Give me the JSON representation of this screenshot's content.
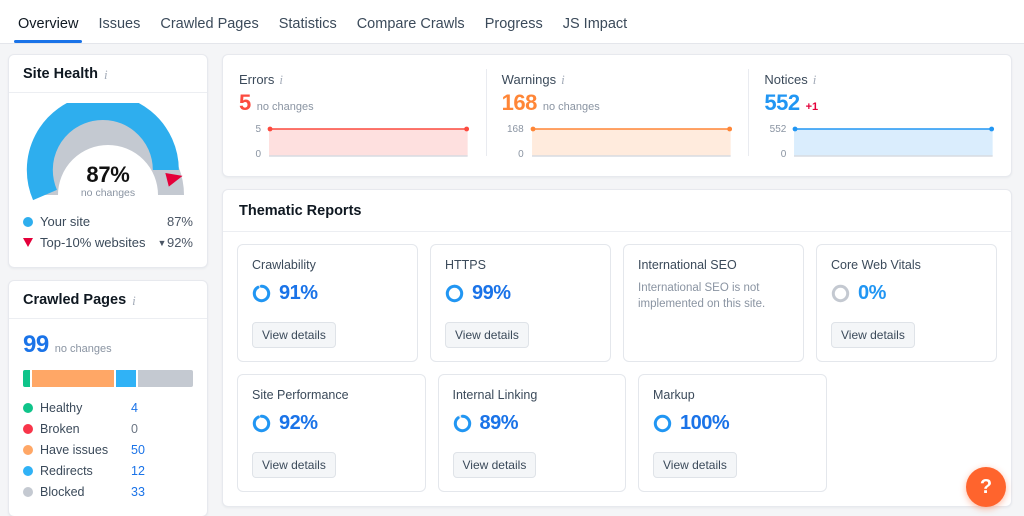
{
  "tabs": [
    {
      "label": "Overview",
      "active": true
    },
    {
      "label": "Issues",
      "active": false
    },
    {
      "label": "Crawled Pages",
      "active": false
    },
    {
      "label": "Statistics",
      "active": false
    },
    {
      "label": "Compare Crawls",
      "active": false
    },
    {
      "label": "Progress",
      "active": false
    },
    {
      "label": "JS Impact",
      "active": false
    }
  ],
  "site_health": {
    "title": "Site Health",
    "percent_label": "87%",
    "percent_value": 87,
    "change_label": "no changes",
    "benchmark_value": 92,
    "legend": [
      {
        "label": "Your site",
        "value": "87%",
        "marker": "dot",
        "color": "#2eaeee"
      },
      {
        "label": "Top-10% websites",
        "value": "92%",
        "marker": "triangle",
        "color": "#e4003a",
        "has_chevron": true
      }
    ]
  },
  "crawled_pages": {
    "title": "Crawled Pages",
    "total": "99",
    "change_label": "no changes",
    "segments": [
      {
        "label": "Healthy",
        "value": "4",
        "count": 4,
        "color": "#0fc48a"
      },
      {
        "label": "Broken",
        "value": "0",
        "count": 0,
        "color": "#f8354a"
      },
      {
        "label": "Have issues",
        "value": "50",
        "count": 50,
        "color": "#ffa766"
      },
      {
        "label": "Redirects",
        "value": "12",
        "count": 12,
        "color": "#30b2f6"
      },
      {
        "label": "Blocked",
        "value": "33",
        "count": 33,
        "color": "#c4c9d1"
      }
    ]
  },
  "stats": [
    {
      "name": "Errors",
      "value": "5",
      "note": "no changes",
      "delta": "",
      "color": "#fc4a3f",
      "axis_top": "5",
      "axis_bottom": "0"
    },
    {
      "name": "Warnings",
      "value": "168",
      "note": "no changes",
      "delta": "",
      "color": "#ff8637",
      "axis_top": "168",
      "axis_bottom": "0"
    },
    {
      "name": "Notices",
      "value": "552",
      "note": "",
      "delta": "+1",
      "color": "#2196f3",
      "axis_top": "552",
      "axis_bottom": "0"
    }
  ],
  "thematic": {
    "title": "Thematic Reports",
    "button_label": "View details",
    "rows": [
      [
        {
          "name": "Crawlability",
          "percent": "91%",
          "value": 91,
          "ring": "partial",
          "has_button": true,
          "message": ""
        },
        {
          "name": "HTTPS",
          "percent": "99%",
          "value": 99,
          "ring": "partial",
          "has_button": true,
          "message": ""
        },
        {
          "name": "International SEO",
          "percent": "",
          "value": null,
          "ring": "none",
          "has_button": false,
          "message": "International SEO is not implemented on this site."
        },
        {
          "name": "Core Web Vitals",
          "percent": "0%",
          "value": 0,
          "ring": "empty",
          "has_button": true,
          "message": ""
        }
      ],
      [
        {
          "name": "Site Performance",
          "percent": "92%",
          "value": 92,
          "ring": "partial",
          "has_button": true,
          "message": ""
        },
        {
          "name": "Internal Linking",
          "percent": "89%",
          "value": 89,
          "ring": "partial",
          "has_button": true,
          "message": ""
        },
        {
          "name": "Markup",
          "percent": "100%",
          "value": 100,
          "ring": "full",
          "has_button": true,
          "message": ""
        }
      ]
    ]
  },
  "help": {
    "label": "?"
  },
  "info_icon": "i"
}
